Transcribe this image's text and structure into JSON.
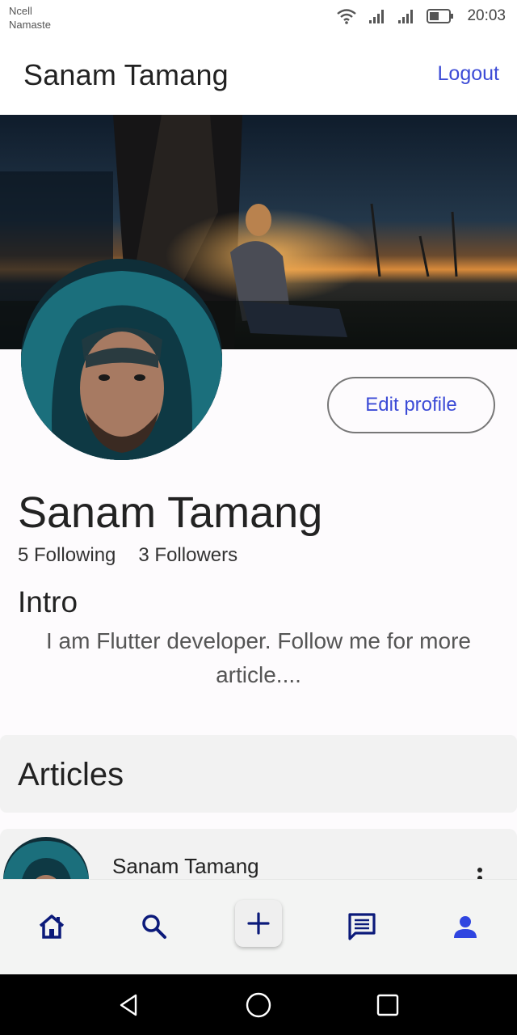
{
  "status_bar": {
    "carrier_line1": "Ncell",
    "carrier_line2": "Namaste",
    "time": "20:03"
  },
  "app_bar": {
    "title": "Sanam Tamang",
    "logout_label": "Logout"
  },
  "profile": {
    "edit_label": "Edit profile",
    "name": "Sanam Tamang",
    "following": "5 Following",
    "followers": "3 Followers",
    "intro_title": "Intro",
    "intro_text": "I am Flutter developer. Follow me for more article...."
  },
  "articles": {
    "title": "Articles",
    "items": [
      {
        "author": "Sanam Tamang"
      }
    ]
  },
  "bottom_nav": {
    "items": [
      "home-icon",
      "search-icon",
      "add-icon",
      "chat-icon",
      "person-icon"
    ],
    "active": "person-icon"
  },
  "colors": {
    "accent": "#3c4bd6",
    "nav_icon": "#0b1a7a",
    "active_icon": "#2f45e0"
  }
}
